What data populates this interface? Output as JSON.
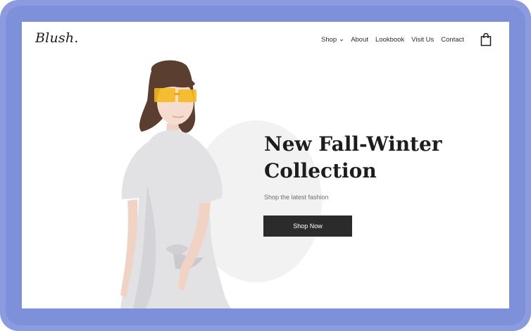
{
  "brand": {
    "logo": "Blush."
  },
  "nav": {
    "items": [
      {
        "label": "Shop",
        "has_dropdown": true
      },
      {
        "label": "About"
      },
      {
        "label": "Lookbook"
      },
      {
        "label": "Visit Us"
      },
      {
        "label": "Contact"
      }
    ]
  },
  "hero": {
    "title_line1": "New Fall-Winter",
    "title_line2": "Collection",
    "subtitle": "Shop the latest fashion",
    "cta": "Shop Now"
  },
  "icons": {
    "cart": "shopping-bag-icon",
    "dropdown": "chevron-down-icon"
  },
  "colors": {
    "frame": "#8c9be0",
    "page_bg": "#ffffff",
    "text": "#1d1d1d",
    "button_bg": "#2b2b2b",
    "circle": "#f2f2f2",
    "sunglasses": "#f5b81c"
  }
}
